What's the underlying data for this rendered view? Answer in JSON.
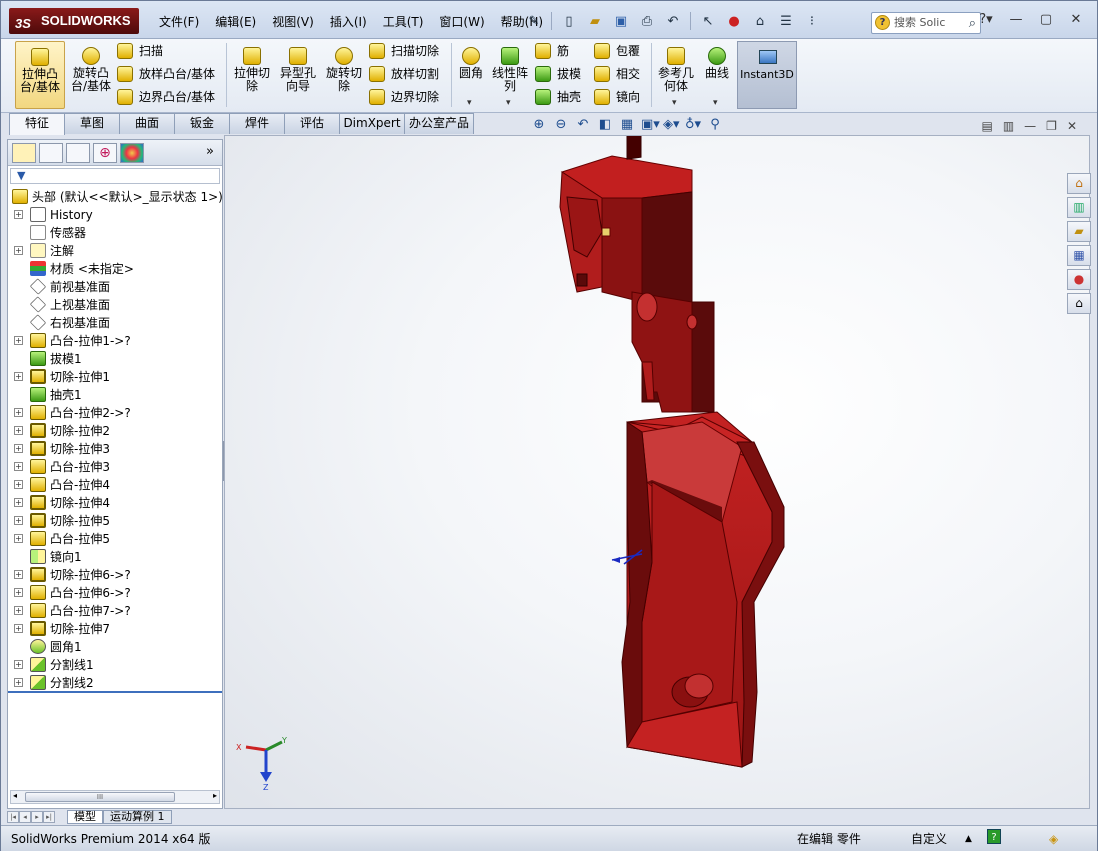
{
  "app": {
    "logo_text": "SOLIDWORKS",
    "menus": [
      "文件(F)",
      "编辑(E)",
      "视图(V)",
      "插入(I)",
      "工具(T)",
      "窗口(W)",
      "帮助(H)"
    ],
    "search_placeholder": "搜索 Solic"
  },
  "command_manager": {
    "big_buttons": [
      "拉伸凸台/基体",
      "旋转凸台/基体",
      "拉伸切除",
      "异型孔向导",
      "旋转切除",
      "圆角",
      "线性阵列",
      "参考几何体",
      "曲线",
      "Instant3D"
    ],
    "small_buttons": [
      "扫描",
      "放样凸台/基体",
      "边界凸台/基体",
      "扫描切除",
      "放样切割",
      "边界切除",
      "筋",
      "拔模",
      "抽壳",
      "包覆",
      "相交",
      "镜向"
    ]
  },
  "tabs": [
    "特征",
    "草图",
    "曲面",
    "钣金",
    "焊件",
    "评估",
    "DimXpert",
    "办公室产品"
  ],
  "feature_tree": {
    "root": "头部 (默认<<默认>_显示状态 1>)",
    "items": [
      {
        "label": "History",
        "icon": "history-icon",
        "expand": true
      },
      {
        "label": "传感器",
        "icon": "sensor-icon",
        "expand": false
      },
      {
        "label": "注解",
        "icon": "annotation-icon",
        "expand": true
      },
      {
        "label": "材质 <未指定>",
        "icon": "material-icon",
        "expand": false
      },
      {
        "label": "前视基准面",
        "icon": "plane-icon",
        "expand": false
      },
      {
        "label": "上视基准面",
        "icon": "plane-icon",
        "expand": false
      },
      {
        "label": "右视基准面",
        "icon": "plane-icon",
        "expand": false
      },
      {
        "label": "凸台-拉伸1->?",
        "icon": "boss-extrude-icon",
        "expand": true
      },
      {
        "label": "拔模1",
        "icon": "draft-icon",
        "expand": false
      },
      {
        "label": "切除-拉伸1",
        "icon": "cut-extrude-icon",
        "expand": true
      },
      {
        "label": "抽壳1",
        "icon": "shell-icon",
        "expand": false
      },
      {
        "label": "凸台-拉伸2->?",
        "icon": "boss-extrude-icon",
        "expand": true
      },
      {
        "label": "切除-拉伸2",
        "icon": "cut-extrude-icon",
        "expand": true
      },
      {
        "label": "切除-拉伸3",
        "icon": "cut-extrude-icon",
        "expand": true
      },
      {
        "label": "凸台-拉伸3",
        "icon": "boss-extrude-icon",
        "expand": true
      },
      {
        "label": "凸台-拉伸4",
        "icon": "boss-extrude-icon",
        "expand": true
      },
      {
        "label": "切除-拉伸4",
        "icon": "cut-extrude-icon",
        "expand": true
      },
      {
        "label": "切除-拉伸5",
        "icon": "cut-extrude-icon",
        "expand": true
      },
      {
        "label": "凸台-拉伸5",
        "icon": "boss-extrude-icon",
        "expand": true
      },
      {
        "label": "镜向1",
        "icon": "mirror-icon",
        "expand": false
      },
      {
        "label": "切除-拉伸6->?",
        "icon": "cut-extrude-icon",
        "expand": true
      },
      {
        "label": "凸台-拉伸6->?",
        "icon": "boss-extrude-icon",
        "expand": true
      },
      {
        "label": "凸台-拉伸7->?",
        "icon": "boss-extrude-icon",
        "expand": true
      },
      {
        "label": "切除-拉伸7",
        "icon": "cut-extrude-icon",
        "expand": true
      },
      {
        "label": "圆角1",
        "icon": "fillet-icon",
        "expand": false
      },
      {
        "label": "分割线1",
        "icon": "split-line-icon",
        "expand": true
      },
      {
        "label": "分割线2",
        "icon": "split-line-icon",
        "expand": true
      }
    ]
  },
  "scroll_thumb": "III",
  "bottom_tabs": [
    "模型",
    "运动算例 1"
  ],
  "status": {
    "version": "SolidWorks Premium 2014 x64 版",
    "mode": "在编辑 零件",
    "units": "自定义"
  },
  "triad": {
    "x": "X",
    "y": "Y",
    "z": "Z"
  },
  "colors": {
    "part": "#8b1010",
    "part_light": "#b52222",
    "accent": "#3d6fbd"
  }
}
